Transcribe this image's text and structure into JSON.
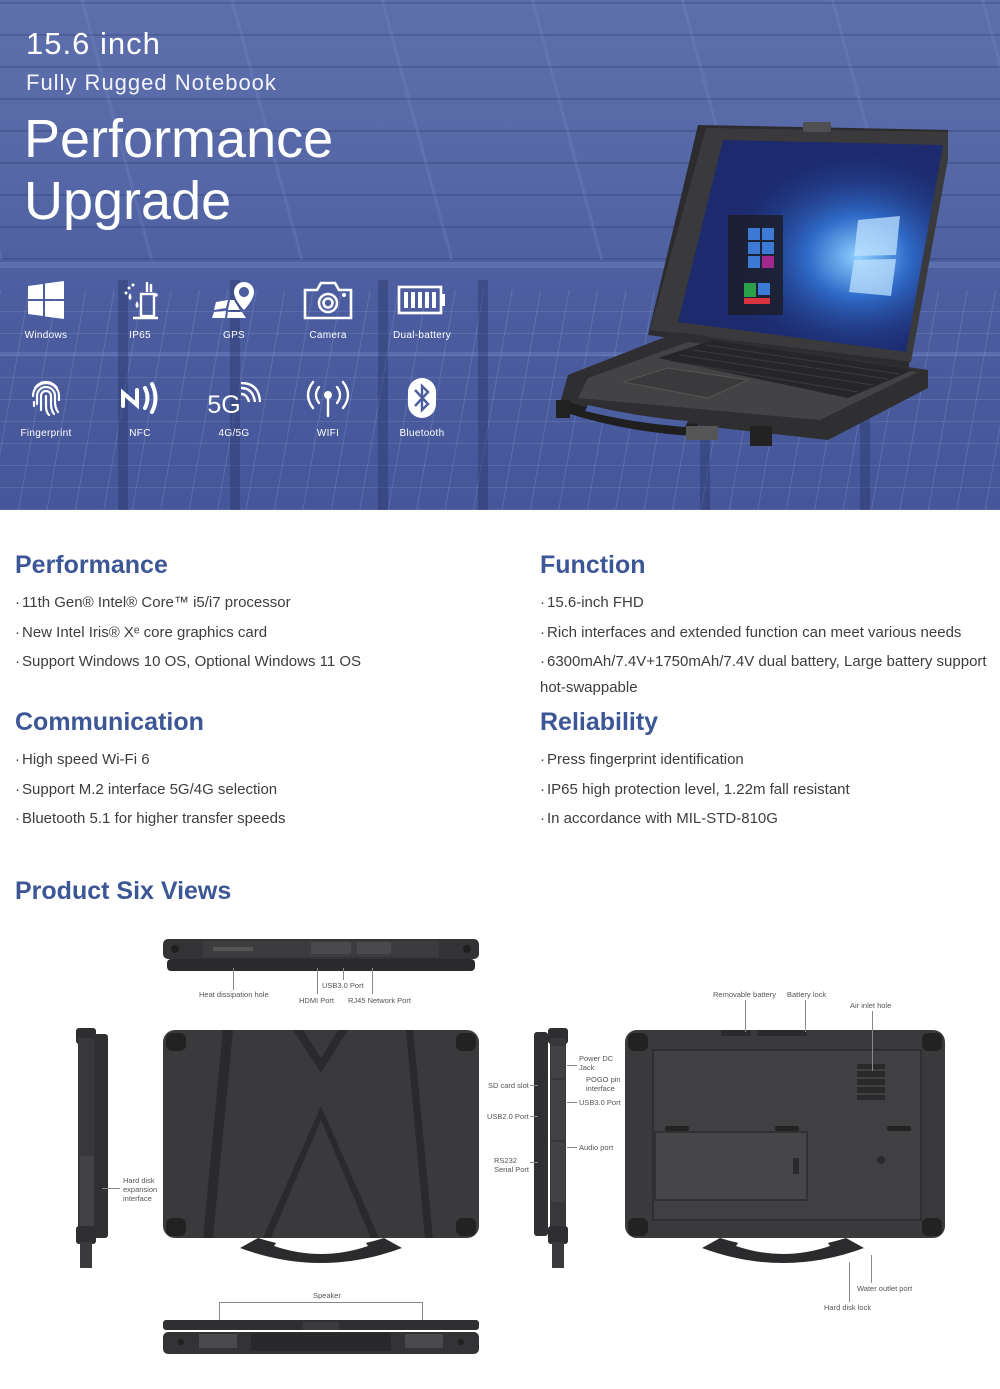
{
  "hero": {
    "size_line": "15.6 inch",
    "type_line": "Fully Rugged Notebook",
    "title_line1": "Performance",
    "title_line2": "Upgrade",
    "features_row1": [
      {
        "icon": "windows-icon",
        "label": "Windows"
      },
      {
        "icon": "ip65-icon",
        "label": "IP65"
      },
      {
        "icon": "gps-icon",
        "label": "GPS"
      },
      {
        "icon": "camera-icon",
        "label": "Camera"
      },
      {
        "icon": "battery-icon",
        "label": "Dual-battery"
      }
    ],
    "features_row2": [
      {
        "icon": "fingerprint-icon",
        "label": "Fingerprint"
      },
      {
        "icon": "nfc-icon",
        "label": "NFC"
      },
      {
        "icon": "5g-icon",
        "label": "4G/5G",
        "glyph": "5G"
      },
      {
        "icon": "wifi-icon",
        "label": "WIFI"
      },
      {
        "icon": "bluetooth-icon",
        "label": "Bluetooth"
      }
    ]
  },
  "sections": {
    "performance": {
      "title": "Performance",
      "items": [
        "11th Gen® Intel® Core™ i5/i7 processor",
        "New Intel Iris® Xᵉ core graphics card",
        "Support Windows 10 OS, Optional Windows 11 OS"
      ]
    },
    "function": {
      "title": "Function",
      "items": [
        "15.6-inch FHD",
        "Rich interfaces and extended function can meet various needs",
        "6300mAh/7.4V+1750mAh/7.4V dual battery, Large battery support hot-swappable"
      ]
    },
    "communication": {
      "title": "Communication",
      "items": [
        "High speed Wi-Fi 6",
        "Support M.2 interface 5G/4G selection",
        "Bluetooth 5.1 for higher transfer speeds"
      ]
    },
    "reliability": {
      "title": "Reliability",
      "items": [
        "Press fingerprint identification",
        "IP65 high protection level, 1.22m fall resistant",
        "In accordance with MIL-STD-810G"
      ]
    }
  },
  "bullet": "·",
  "views": {
    "title": "Product Six Views",
    "rear_labels": {
      "heat": "Heat dissipation hole",
      "usb3": "USB3.0 Port",
      "hdmi": "HDMI Port",
      "rj45": "RJ45 Network Port"
    },
    "left_labels": {
      "hdd": "Hard disk\nexpansion\ninterface"
    },
    "right_labels": {
      "sd": "SD card slot",
      "usb2": "USB2.0 Port",
      "rs232": "RS232\nSerial Port",
      "power": "Power DC\nJack",
      "pogo": "POGO pin\ninterface",
      "usb3": "USB3.0 Port",
      "audio": "Audio port"
    },
    "bottom_labels": {
      "battery": "Removable battery",
      "lock": "Battery lock",
      "air": "Air inlet hole",
      "water": "Water outlet port",
      "hddlock": "Hard disk lock"
    },
    "front_labels": {
      "speaker": "Speaker"
    }
  }
}
